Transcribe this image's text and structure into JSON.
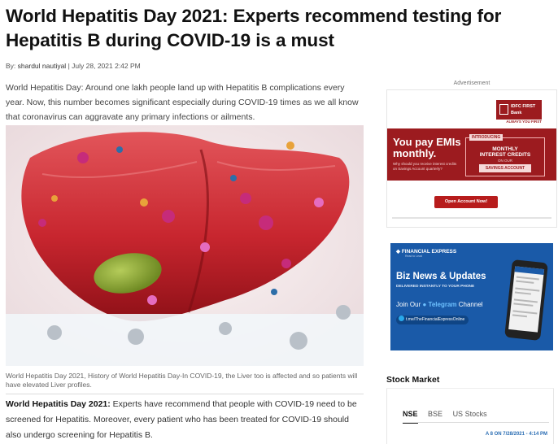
{
  "article": {
    "title": "World Hepatitis Day 2021: Experts recommend testing for Hepatitis B during COVID-19 is a must",
    "by_label": "By:",
    "author": "shardul nautiyal",
    "separator": "|",
    "date": "July 28, 2021 2:42 PM",
    "summary": "World Hepatitis Day: Around one lakh people land up with Hepatitis B complications every year. Now, this number becomes significant especially during COVID-19 times as we all know that coronavirus can aggravate any primary infections or ailments.",
    "image_caption": "World Hepatitis Day 2021, History of World Hepatitis Day-In COVID-19, the Liver too is affected and so patients will have elevated Liver profiles.",
    "body_lead": "World Hepatitis Day 2021:",
    "body_text": " Experts have recommend that people with COVID-19 need to be screened for Hepatitis. Moreover, every patient who has been treated for COVID-19 should also undergo screening for Hepatitis B."
  },
  "sidebar": {
    "ad_label": "Advertisement",
    "bank_ad": {
      "logo": "IDFC FIRST Bank",
      "tagline": "ALWAYS YOU FIRST",
      "headline_line1": "You pay EMIs",
      "headline_line2": "monthly.",
      "subtext": "Why should you receive interest credits on Savings Account quarterly?",
      "intro_tag": "INTRODUCING",
      "intro_main_line1": "MONTHLY",
      "intro_main_line2": "INTEREST CREDITS",
      "intro_on": "ON OUR",
      "intro_product": "SAVINGS ACCOUNT",
      "cta": "Open Account Now!"
    },
    "fe_ad": {
      "brand": "FINANCIAL EXPRESS",
      "brand_sub": "Read to Lead",
      "headline": "Biz News & Updates",
      "subhead": "DELIVERED INSTANTLY TO YOUR PHONE",
      "join_prefix": "Join Our ",
      "join_telegram": "Telegram",
      "join_suffix": " Channel",
      "link": "t.me/TheFinancialExpressOnline"
    },
    "stock_market": {
      "title": "Stock Market",
      "tabs": [
        "NSE",
        "BSE",
        "US Stocks"
      ],
      "active_tab": "NSE",
      "timestamp": "A 8 ON 7/28/2021 - 4:14 PM"
    }
  },
  "colors": {
    "idfc_red": "#9c1b1f",
    "fe_blue": "#1a5aa8",
    "link_blue": "#2a6db3"
  }
}
